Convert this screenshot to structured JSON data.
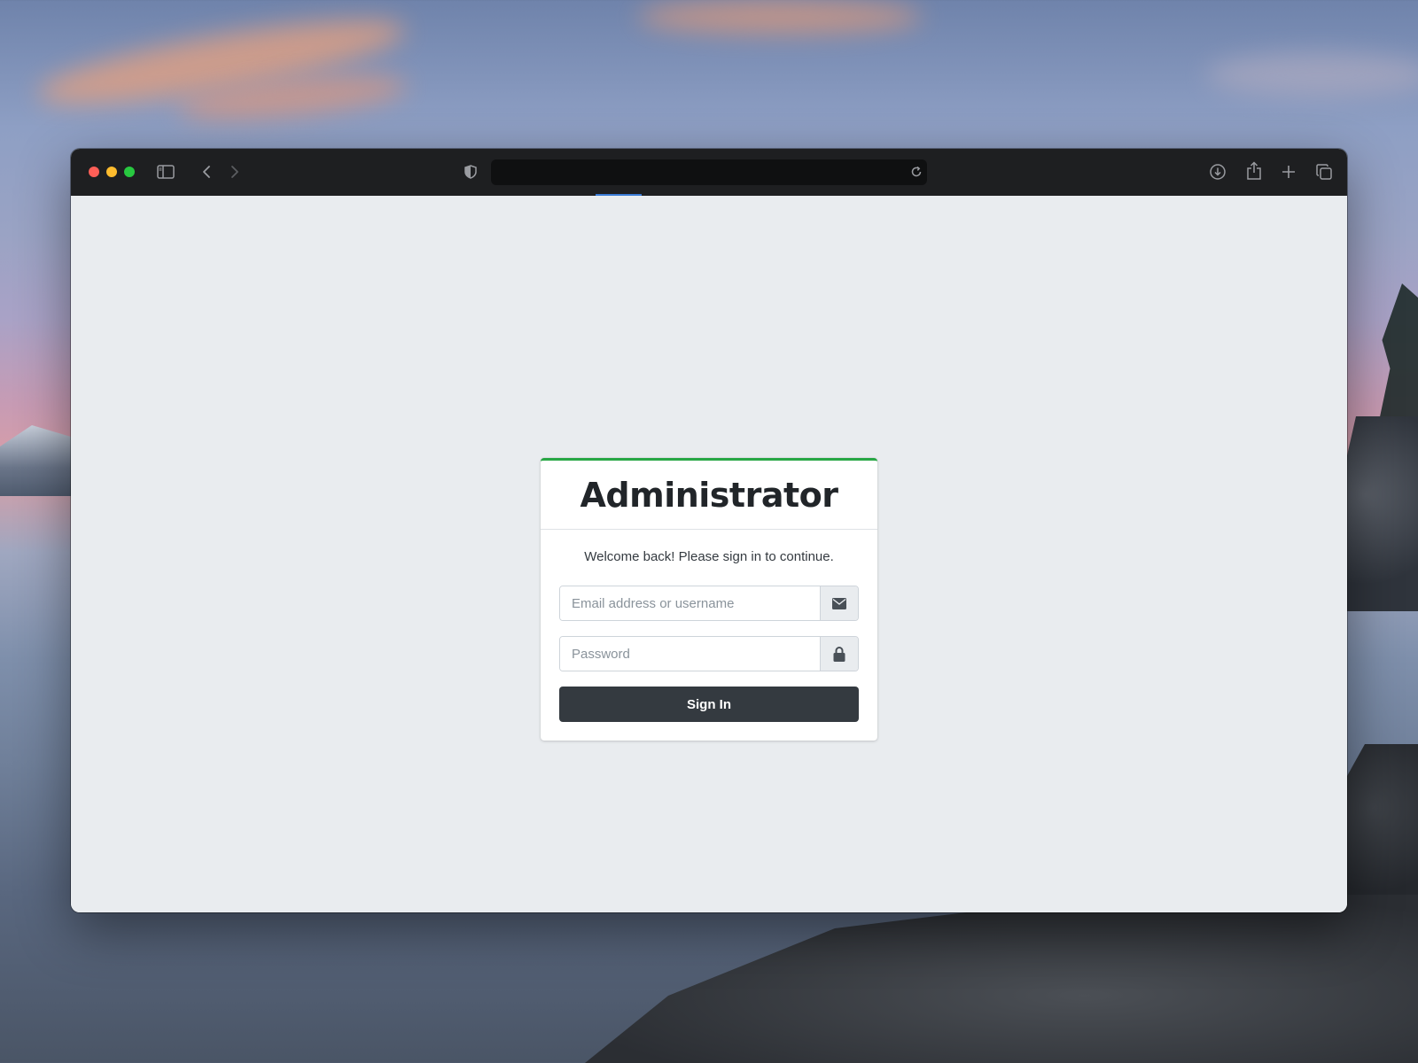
{
  "browser": {
    "url": "",
    "icons": {
      "sidebar": "sidebar-icon",
      "back": "chevron-left-icon",
      "forward": "chevron-right-icon",
      "privacy": "shield-icon",
      "reload": "reload-icon",
      "download": "download-icon",
      "share": "share-icon",
      "new_tab": "plus-icon",
      "tab_overview": "tabs-icon"
    }
  },
  "login": {
    "title": "Administrator",
    "message": "Welcome back! Please sign in to continue.",
    "email": {
      "value": "",
      "placeholder": "Email address or username",
      "icon": "envelope-icon"
    },
    "password": {
      "value": "",
      "placeholder": "Password",
      "icon": "lock-icon"
    },
    "submit_label": "Sign In",
    "accent_color": "#28a745",
    "button_color": "#343a40"
  }
}
